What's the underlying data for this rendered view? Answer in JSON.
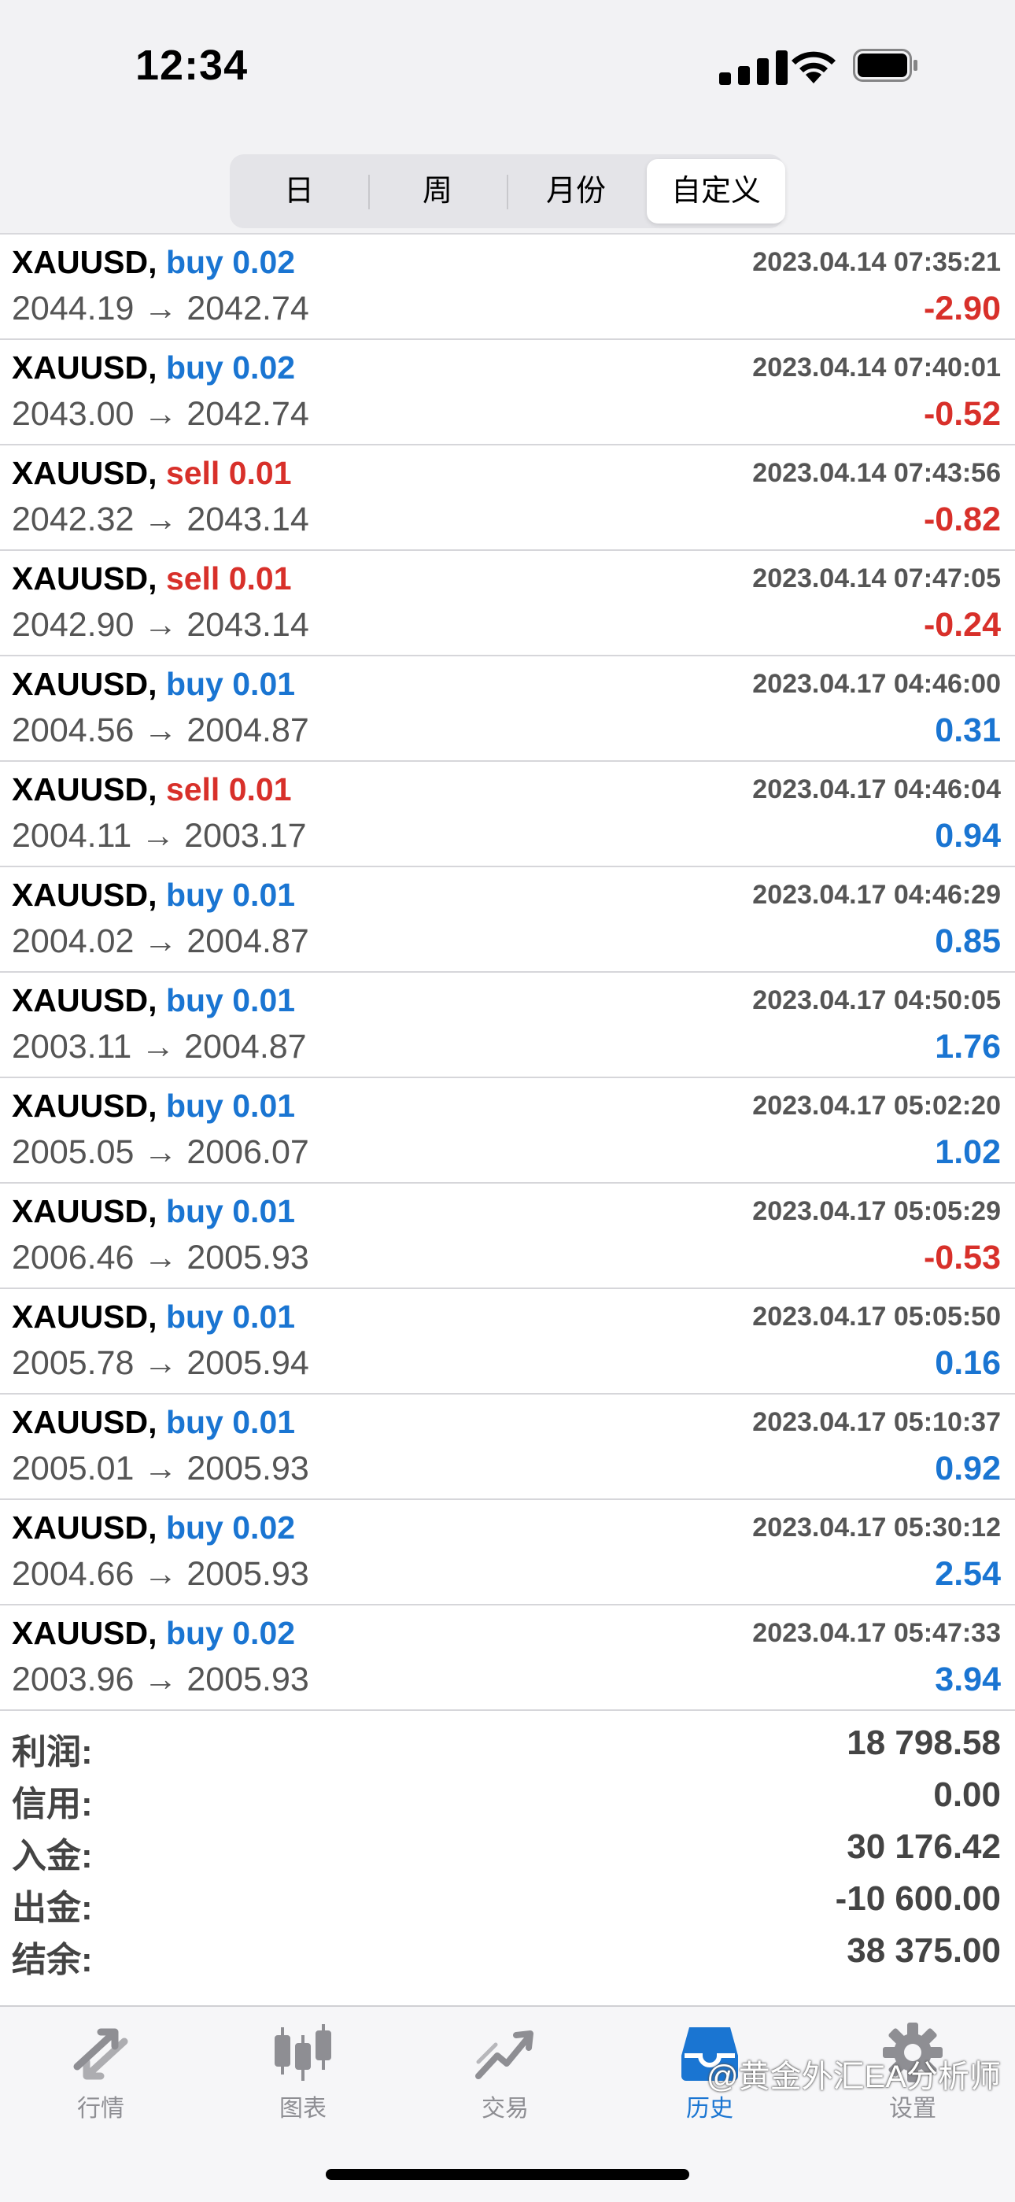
{
  "status_bar": {
    "time": "12:34"
  },
  "segments": [
    {
      "label": "日",
      "active": false
    },
    {
      "label": "周",
      "active": false
    },
    {
      "label": "月份",
      "active": false
    },
    {
      "label": "自定义",
      "active": true
    }
  ],
  "trades": [
    {
      "symbol": "XAUUSD,",
      "side": "buy",
      "volume": "0.02",
      "open": "2044.19",
      "close": "2042.74",
      "time": "2023.04.14 07:35:21",
      "profit": "-2.90"
    },
    {
      "symbol": "XAUUSD,",
      "side": "buy",
      "volume": "0.02",
      "open": "2043.00",
      "close": "2042.74",
      "time": "2023.04.14 07:40:01",
      "profit": "-0.52"
    },
    {
      "symbol": "XAUUSD,",
      "side": "sell",
      "volume": "0.01",
      "open": "2042.32",
      "close": "2043.14",
      "time": "2023.04.14 07:43:56",
      "profit": "-0.82"
    },
    {
      "symbol": "XAUUSD,",
      "side": "sell",
      "volume": "0.01",
      "open": "2042.90",
      "close": "2043.14",
      "time": "2023.04.14 07:47:05",
      "profit": "-0.24"
    },
    {
      "symbol": "XAUUSD,",
      "side": "buy",
      "volume": "0.01",
      "open": "2004.56",
      "close": "2004.87",
      "time": "2023.04.17 04:46:00",
      "profit": "0.31"
    },
    {
      "symbol": "XAUUSD,",
      "side": "sell",
      "volume": "0.01",
      "open": "2004.11",
      "close": "2003.17",
      "time": "2023.04.17 04:46:04",
      "profit": "0.94"
    },
    {
      "symbol": "XAUUSD,",
      "side": "buy",
      "volume": "0.01",
      "open": "2004.02",
      "close": "2004.87",
      "time": "2023.04.17 04:46:29",
      "profit": "0.85"
    },
    {
      "symbol": "XAUUSD,",
      "side": "buy",
      "volume": "0.01",
      "open": "2003.11",
      "close": "2004.87",
      "time": "2023.04.17 04:50:05",
      "profit": "1.76"
    },
    {
      "symbol": "XAUUSD,",
      "side": "buy",
      "volume": "0.01",
      "open": "2005.05",
      "close": "2006.07",
      "time": "2023.04.17 05:02:20",
      "profit": "1.02"
    },
    {
      "symbol": "XAUUSD,",
      "side": "buy",
      "volume": "0.01",
      "open": "2006.46",
      "close": "2005.93",
      "time": "2023.04.17 05:05:29",
      "profit": "-0.53"
    },
    {
      "symbol": "XAUUSD,",
      "side": "buy",
      "volume": "0.01",
      "open": "2005.78",
      "close": "2005.94",
      "time": "2023.04.17 05:05:50",
      "profit": "0.16"
    },
    {
      "symbol": "XAUUSD,",
      "side": "buy",
      "volume": "0.01",
      "open": "2005.01",
      "close": "2005.93",
      "time": "2023.04.17 05:10:37",
      "profit": "0.92"
    },
    {
      "symbol": "XAUUSD,",
      "side": "buy",
      "volume": "0.02",
      "open": "2004.66",
      "close": "2005.93",
      "time": "2023.04.17 05:30:12",
      "profit": "2.54"
    },
    {
      "symbol": "XAUUSD,",
      "side": "buy",
      "volume": "0.02",
      "open": "2003.96",
      "close": "2005.93",
      "time": "2023.04.17 05:47:33",
      "profit": "3.94"
    }
  ],
  "arrow": "→",
  "summary": [
    {
      "label": "利润:",
      "value": "18 798.58"
    },
    {
      "label": "信用:",
      "value": "0.00"
    },
    {
      "label": "入金:",
      "value": "30 176.42"
    },
    {
      "label": "出金:",
      "value": "-10 600.00"
    },
    {
      "label": "结余:",
      "value": "38 375.00"
    }
  ],
  "tabs": [
    {
      "label": "行情",
      "icon": "quotes-arrows-icon",
      "active": false
    },
    {
      "label": "图表",
      "icon": "candlestick-chart-icon",
      "active": false
    },
    {
      "label": "交易",
      "icon": "trade-line-icon",
      "active": false
    },
    {
      "label": "历史",
      "icon": "history-inbox-icon",
      "active": true
    },
    {
      "label": "设置",
      "icon": "gear-icon",
      "active": false
    }
  ],
  "watermark": "@黄金外汇EA分析师",
  "colors": {
    "buy": "#1a75d2",
    "sell": "#d8302a",
    "positive": "#1a75d2",
    "negative": "#d8302a",
    "active_tab": "#1a75d2",
    "inactive_tab": "#8e8e93"
  }
}
